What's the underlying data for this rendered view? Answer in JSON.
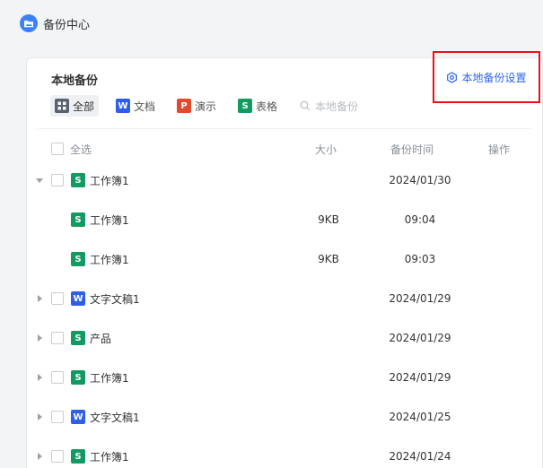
{
  "app": {
    "title": "备份中心"
  },
  "panel": {
    "title": "本地备份",
    "settings_label": "本地备份设置"
  },
  "filters": [
    {
      "label": "全部",
      "icon": "grid-icon",
      "active": true
    },
    {
      "label": "文档",
      "icon": "W",
      "type": "w"
    },
    {
      "label": "演示",
      "icon": "P",
      "type": "p"
    },
    {
      "label": "表格",
      "icon": "S",
      "type": "s"
    }
  ],
  "search": {
    "placeholder": "本地备份"
  },
  "table": {
    "select_all": "全选",
    "col_size": "大小",
    "col_time": "备份时间",
    "col_action": "操作",
    "rows": [
      {
        "name": "工作簿1",
        "type": "s",
        "size": "",
        "time": "2024/01/30",
        "expanded": true,
        "child": false
      },
      {
        "name": "工作簿1",
        "type": "s",
        "size": "9KB",
        "time": "09:04",
        "child": true
      },
      {
        "name": "工作簿1",
        "type": "s",
        "size": "9KB",
        "time": "09:03",
        "child": true
      },
      {
        "name": "文字文稿1",
        "type": "w",
        "size": "",
        "time": "2024/01/29",
        "expanded": false,
        "child": false
      },
      {
        "name": "产品",
        "type": "s",
        "size": "",
        "time": "2024/01/29",
        "expanded": false,
        "child": false
      },
      {
        "name": "工作簿1",
        "type": "s",
        "size": "",
        "time": "2024/01/29",
        "expanded": false,
        "child": false
      },
      {
        "name": "文字文稿1",
        "type": "w",
        "size": "",
        "time": "2024/01/25",
        "expanded": false,
        "child": false
      },
      {
        "name": "工作簿1",
        "type": "s",
        "size": "",
        "time": "2024/01/24",
        "expanded": false,
        "child": false
      }
    ]
  }
}
